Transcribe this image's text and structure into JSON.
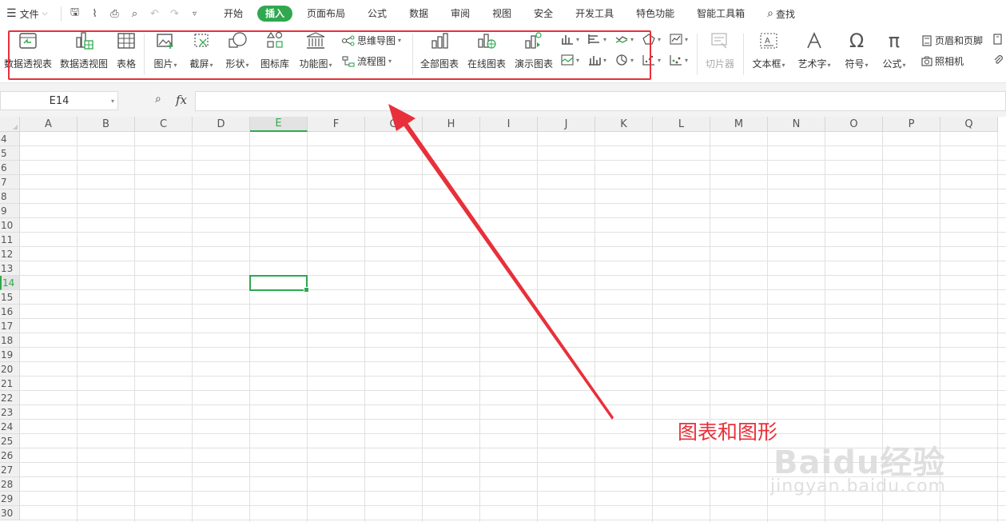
{
  "menubar": {
    "file_label": "文件",
    "tabs": [
      "开始",
      "插入",
      "页面布局",
      "公式",
      "数据",
      "审阅",
      "视图",
      "安全",
      "开发工具",
      "特色功能",
      "智能工具箱"
    ],
    "active_tab": "插入",
    "search_label": "查找"
  },
  "ribbon": {
    "pivot_table": "数据透视表",
    "pivot_chart": "数据透视图",
    "table": "表格",
    "picture": "图片",
    "screenshot": "截屏",
    "shape": "形状",
    "icon_lib": "图标库",
    "function_chart": "功能图",
    "mind_map": "思维导图",
    "flowchart": "流程图",
    "all_charts": "全部图表",
    "online_charts": "在线图表",
    "demo_charts": "演示图表",
    "slicer": "切片器",
    "textbox": "文本框",
    "wordart": "艺术字",
    "symbol": "符号",
    "equation": "公式",
    "header_footer": "页眉和页脚",
    "camera": "照相机"
  },
  "formula_bar": {
    "name_box": "E14",
    "fx": "fx",
    "formula": ""
  },
  "grid": {
    "columns": [
      "A",
      "B",
      "C",
      "D",
      "E",
      "F",
      "G",
      "H",
      "I",
      "J",
      "K",
      "L",
      "M",
      "N",
      "O",
      "P",
      "Q"
    ],
    "rows": [
      "4",
      "5",
      "6",
      "7",
      "8",
      "9",
      "10",
      "11",
      "12",
      "13",
      "14",
      "15",
      "16",
      "17",
      "18",
      "19",
      "20",
      "21",
      "22",
      "23",
      "24",
      "25",
      "26",
      "27",
      "28",
      "29",
      "30"
    ],
    "selected_column": "E",
    "selected_row": "14"
  },
  "annotation": {
    "label": "图表和图形",
    "color": "#e8303a"
  },
  "watermark": {
    "brand": "Baidu经验",
    "site": "jingyan.baidu.com"
  },
  "colors": {
    "accent": "#2fa84f",
    "annotation": "#e8303a"
  }
}
